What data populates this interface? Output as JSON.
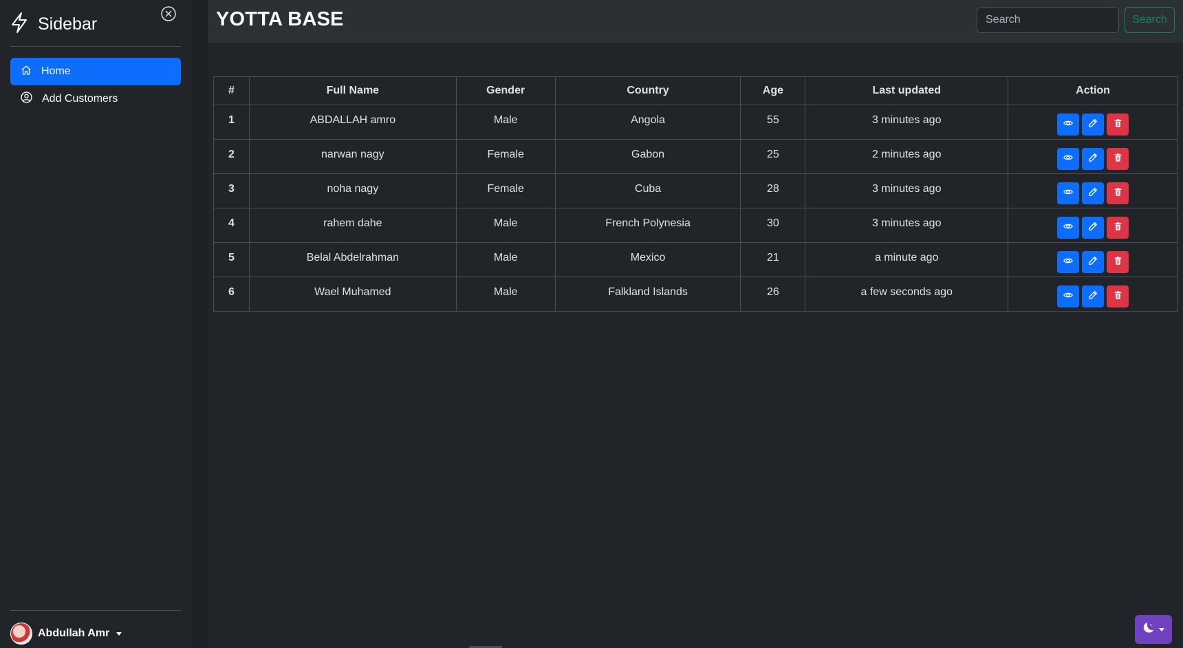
{
  "sidebar": {
    "brand_title": "Sidebar",
    "brand_icon": "lightning-icon",
    "close_icon": "close-circle-icon",
    "nav": [
      {
        "label": "Home",
        "icon": "house-icon",
        "active": true
      },
      {
        "label": "Add Customers",
        "icon": "person-circle-icon",
        "active": false
      }
    ],
    "user": {
      "name": "Abdullah Amr"
    }
  },
  "header": {
    "title": "YOTTA BASE",
    "search_placeholder": "Search",
    "search_button": "Search"
  },
  "table": {
    "columns": [
      "#",
      "Full Name",
      "Gender",
      "Country",
      "Age",
      "Last updated",
      "Action"
    ],
    "rows": [
      {
        "idx": "1",
        "name": "ABDALLAH amro",
        "gender": "Male",
        "country": "Angola",
        "age": "55",
        "updated": "3 minutes ago"
      },
      {
        "idx": "2",
        "name": "narwan nagy",
        "gender": "Female",
        "country": "Gabon",
        "age": "25",
        "updated": "2 minutes ago"
      },
      {
        "idx": "3",
        "name": "noha nagy",
        "gender": "Female",
        "country": "Cuba",
        "age": "28",
        "updated": "3 minutes ago"
      },
      {
        "idx": "4",
        "name": "rahem dahe",
        "gender": "Male",
        "country": "French Polynesia",
        "age": "30",
        "updated": "3 minutes ago"
      },
      {
        "idx": "5",
        "name": "Belal Abdelrahman",
        "gender": "Male",
        "country": "Mexico",
        "age": "21",
        "updated": "a minute ago"
      },
      {
        "idx": "6",
        "name": "Wael Muhamed",
        "gender": "Male",
        "country": "Falkland Islands",
        "age": "26",
        "updated": "a few seconds ago"
      }
    ],
    "action_icons": [
      "eye-icon",
      "pencil-icon",
      "trash-icon"
    ]
  },
  "colors": {
    "primary": "#0d6efd",
    "danger": "#dc3545",
    "success": "#198754",
    "theme_toggle": "#6f42c1",
    "background": "#212529"
  }
}
